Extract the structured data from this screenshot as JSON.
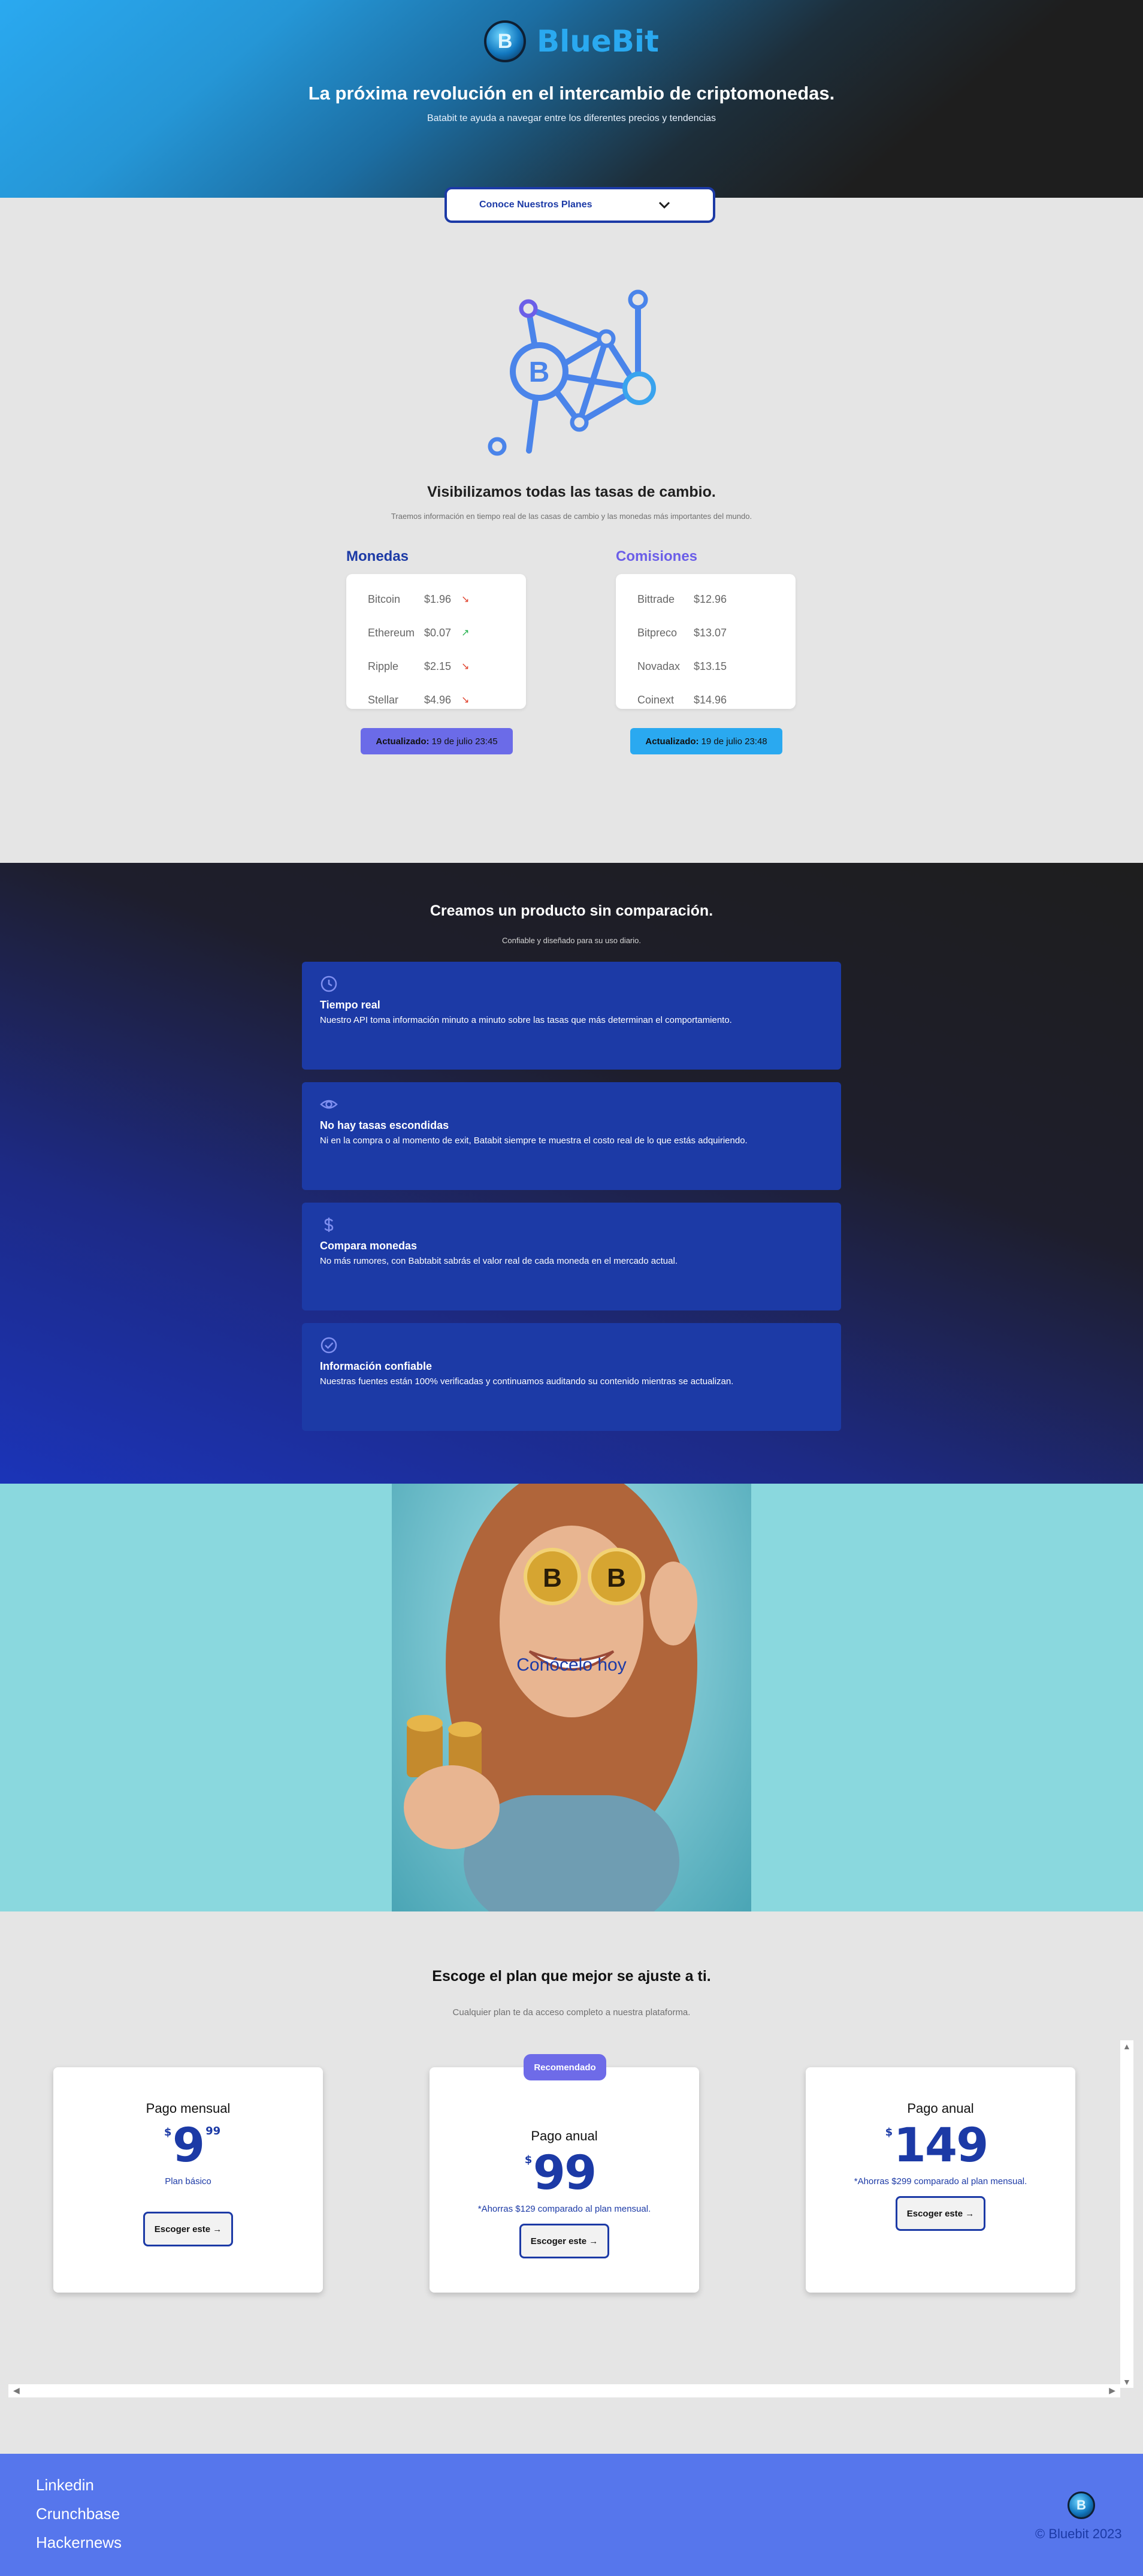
{
  "brand": {
    "name": "BlueBit",
    "logo_symbol": "B"
  },
  "hero": {
    "title": "La próxima revolución en el intercambio de criptomonedas.",
    "subtitle": "Batabit te ayuda a navegar entre los diferentes precios y tendencias"
  },
  "plans_button": {
    "label": "Conoce Nuestros Planes",
    "icon": "chevron-down-icon"
  },
  "exchange": {
    "title": "Visibilizamos todas las tasas de cambio.",
    "subtitle": "Traemos información en tiempo real de las casas de cambio y las monedas más importantes del mundo.",
    "currencies": {
      "title": "Monedas",
      "rows": [
        {
          "name": "Bitcoin",
          "price": "$1.96",
          "trend": "down"
        },
        {
          "name": "Ethereum",
          "price": "$0.07",
          "trend": "up"
        },
        {
          "name": "Ripple",
          "price": "$2.15",
          "trend": "down"
        },
        {
          "name": "Stellar",
          "price": "$4.96",
          "trend": "down"
        }
      ],
      "updated_label": "Actualizado:",
      "updated_value": "19 de julio 23:45"
    },
    "commissions": {
      "title": "Comisiones",
      "rows": [
        {
          "name": "Bittrade",
          "price": "$12.96"
        },
        {
          "name": "Bitpreco",
          "price": "$13.07"
        },
        {
          "name": "Novadax",
          "price": "$13.15"
        },
        {
          "name": "Coinext",
          "price": "$14.96"
        }
      ],
      "updated_label": "Actualizado:",
      "updated_value": "19 de julio 23:48"
    }
  },
  "product": {
    "title": "Creamos un producto sin comparación.",
    "subtitle": "Confiable y diseñado para su uso diario.",
    "features": [
      {
        "icon": "clock-icon",
        "title": "Tiempo real",
        "text": "Nuestro API toma información minuto a minuto sobre las tasas que más determinan el comportamiento."
      },
      {
        "icon": "eye-icon",
        "title": "No hay tasas escondidas",
        "text": "Ni en la compra o al momento de exit, Batabit siempre te muestra el costo real de lo que estás adquiriendo."
      },
      {
        "icon": "dollar-icon",
        "title": "Compara monedas",
        "text": "No más rumores, con Babtabit sabrás el valor real de cada moneda en el mercado actual."
      },
      {
        "icon": "check-circle-icon",
        "title": "Información confiable",
        "text": "Nuestras fuentes están 100% verificadas y continuamos auditando su contenido mientras se actualizan."
      }
    ]
  },
  "cta_image": {
    "text": "Conócelo hoy"
  },
  "pricing": {
    "title": "Escoge el plan que mejor se ajuste a ti.",
    "subtitle": "Cualquier plan te da acceso completo a nuestra plataforma.",
    "badge": "Recomendado",
    "plans": [
      {
        "name": "Pago mensual",
        "currency": "$",
        "amount": "9",
        "cents": "99",
        "note": "Plan básico",
        "button": "Escoger este →"
      },
      {
        "name": "Pago anual",
        "currency": "$",
        "amount": "99",
        "cents": "",
        "note": "*Ahorras $129 comparado al plan mensual.",
        "button": "Escoger este →"
      },
      {
        "name": "Pago anual",
        "currency": "$",
        "amount": "149",
        "cents": "",
        "note": "*Ahorras $299 comparado al plan mensual.",
        "button": "Escoger este →"
      }
    ]
  },
  "footer": {
    "links": [
      "Linkedin",
      "Crunchbase",
      "Hackernews"
    ],
    "copyright": "© Bluebit 2023"
  },
  "colors": {
    "accent": "#1c3aa6",
    "brand": "#2aa9f0",
    "footer": "#5676ec",
    "badge": "#6e6be8",
    "trend_down": "#e0402b",
    "trend_up": "#22b14c"
  }
}
